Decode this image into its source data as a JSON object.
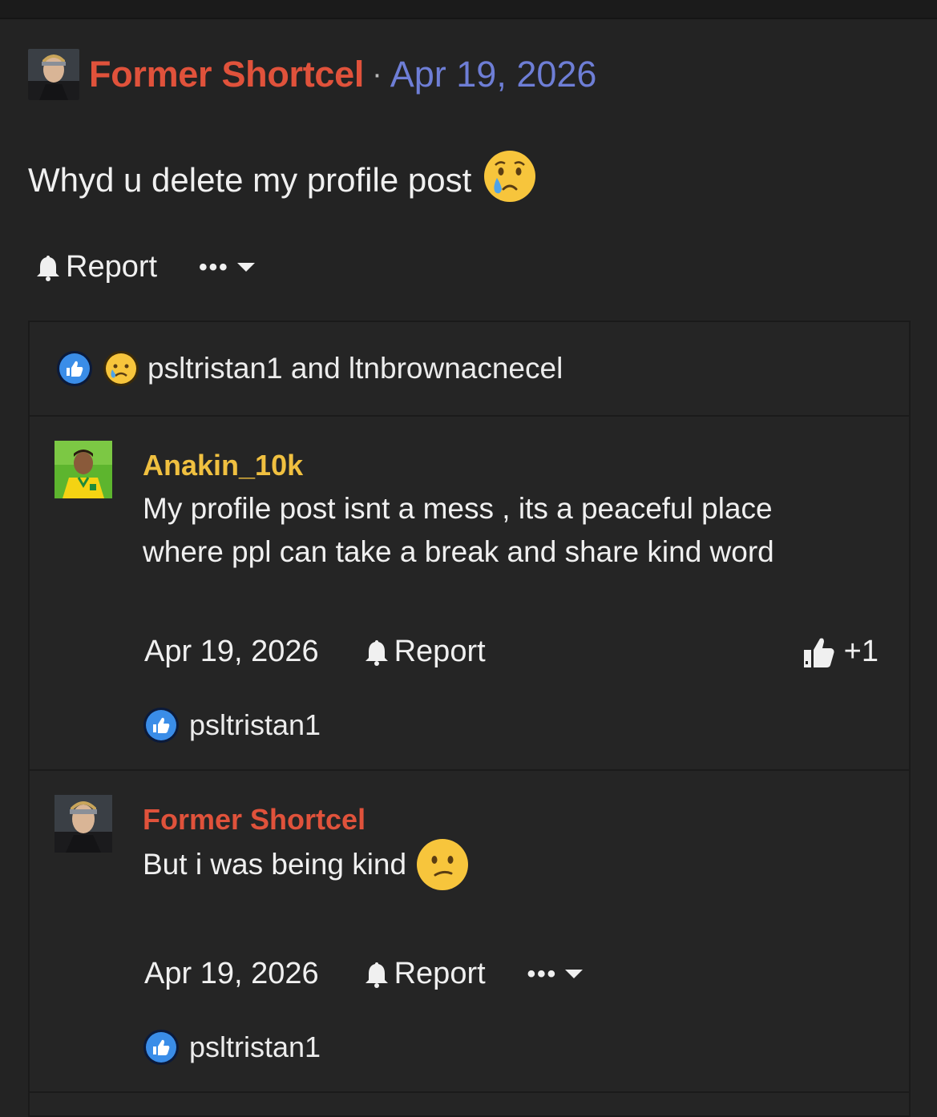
{
  "post": {
    "author": "Former Shortcel",
    "separator": "·",
    "date": "Apr 19, 2026",
    "body": "Whyd u delete my profile post",
    "body_emoji": "crying-face",
    "report_label": "Report",
    "more_label": "•••"
  },
  "reactions_summary": {
    "icons": [
      "like-icon",
      "sad-icon"
    ],
    "text": "psltristan1 and ltnbrownacnecel"
  },
  "comments": [
    {
      "author": "Anakin_10k",
      "author_color": "#f0c040",
      "text": "My profile post isnt a mess , its a peaceful place where ppl can take a break and share kind word",
      "date": "Apr 19, 2026",
      "report_label": "Report",
      "like_count": "+1",
      "reactors": "psltristan1"
    },
    {
      "author": "Former Shortcel",
      "author_color": "#e0523b",
      "text": "But i was being kind",
      "text_emoji": "confused-face",
      "date": "Apr 19, 2026",
      "report_label": "Report",
      "more_label": "•••",
      "reactors": "psltristan1"
    }
  ],
  "colors": {
    "background": "#232323",
    "author_red": "#e0523b",
    "date_blue": "#6e7ed6",
    "like_blue": "#3a8de8"
  }
}
